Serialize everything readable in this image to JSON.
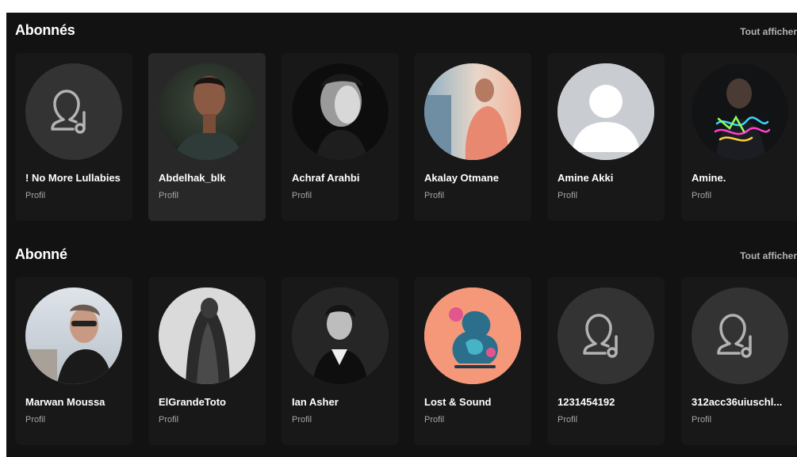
{
  "sections": [
    {
      "title": "Abonnés",
      "show_all": "Tout afficher",
      "cards": [
        {
          "name": "! No More Lullabies",
          "subtitle": "Profil",
          "avatar": "default-user-icon"
        },
        {
          "name": "Abdelhak_blk",
          "subtitle": "Profil",
          "avatar": "photo"
        },
        {
          "name": "Achraf Arahbi",
          "subtitle": "Profil",
          "avatar": "photo"
        },
        {
          "name": "Akalay Otmane",
          "subtitle": "Profil",
          "avatar": "photo"
        },
        {
          "name": "Amine Akki",
          "subtitle": "Profil",
          "avatar": "silhouette"
        },
        {
          "name": "Amine.",
          "subtitle": "Profil",
          "avatar": "photo"
        }
      ]
    },
    {
      "title": "Abonné",
      "show_all": "Tout afficher",
      "cards": [
        {
          "name": "Marwan Moussa",
          "subtitle": "Profil",
          "avatar": "photo"
        },
        {
          "name": "ElGrandeToto",
          "subtitle": "Profil",
          "avatar": "photo"
        },
        {
          "name": "Ian Asher",
          "subtitle": "Profil",
          "avatar": "photo"
        },
        {
          "name": "Lost & Sound",
          "subtitle": "Profil",
          "avatar": "artwork"
        },
        {
          "name": "1231454192",
          "subtitle": "Profil",
          "avatar": "default-user-icon"
        },
        {
          "name": "312acc36uiuschl...",
          "subtitle": "Profil",
          "avatar": "default-user-icon"
        }
      ]
    }
  ],
  "colors": {
    "background": "#121212",
    "card": "#181818",
    "card_hover": "#282828",
    "text_primary": "#ffffff",
    "text_secondary": "#a7a7a7"
  }
}
